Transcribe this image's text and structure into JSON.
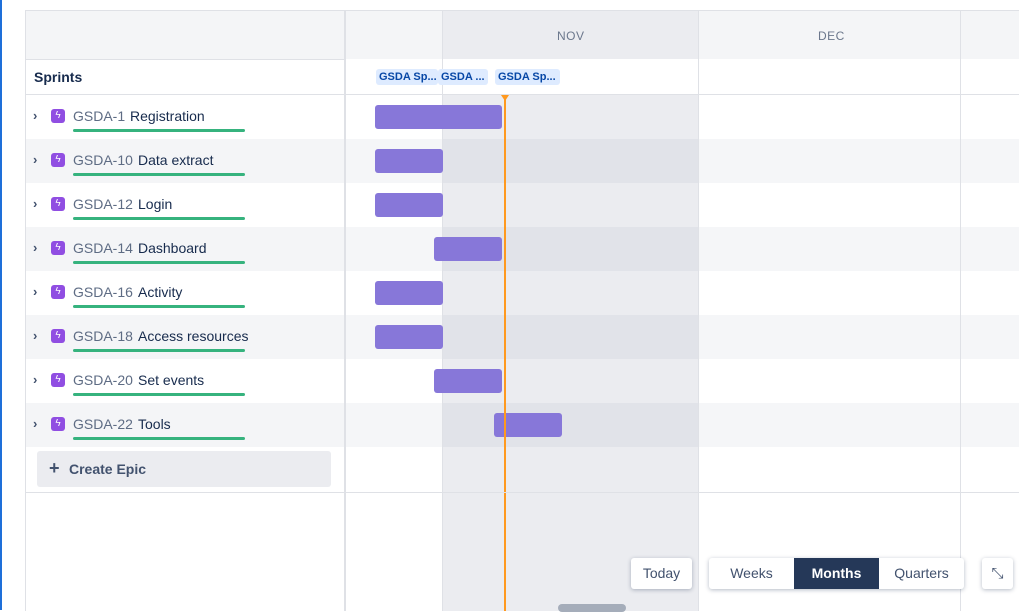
{
  "timeline": {
    "months": [
      "NOV",
      "DEC"
    ],
    "sprints_label": "Sprints",
    "sprint_chips": [
      "GSDA Sp...",
      "GSDA ...",
      "GSDA Sp..."
    ]
  },
  "epics": [
    {
      "key": "GSDA-1",
      "name": "Registration"
    },
    {
      "key": "GSDA-10",
      "name": "Data extract"
    },
    {
      "key": "GSDA-12",
      "name": "Login"
    },
    {
      "key": "GSDA-14",
      "name": "Dashboard"
    },
    {
      "key": "GSDA-16",
      "name": "Activity"
    },
    {
      "key": "GSDA-18",
      "name": "Access resources"
    },
    {
      "key": "GSDA-20",
      "name": "Set events"
    },
    {
      "key": "GSDA-22",
      "name": "Tools"
    }
  ],
  "create_epic_label": "Create Epic",
  "controls": {
    "today_label": "Today",
    "views": [
      "Weeks",
      "Months",
      "Quarters"
    ],
    "active_view": "Months"
  },
  "colors": {
    "epic_bar": "#8777d9",
    "epic_icon": "#904ee2",
    "progress": "#36b37e",
    "today_line": "#ff991f",
    "active_view_bg": "#253858"
  },
  "icons": {
    "expand": "chevron-right-icon",
    "epic": "lightning-icon",
    "create": "plus-icon",
    "fit": "collapse-arrows-icon"
  }
}
